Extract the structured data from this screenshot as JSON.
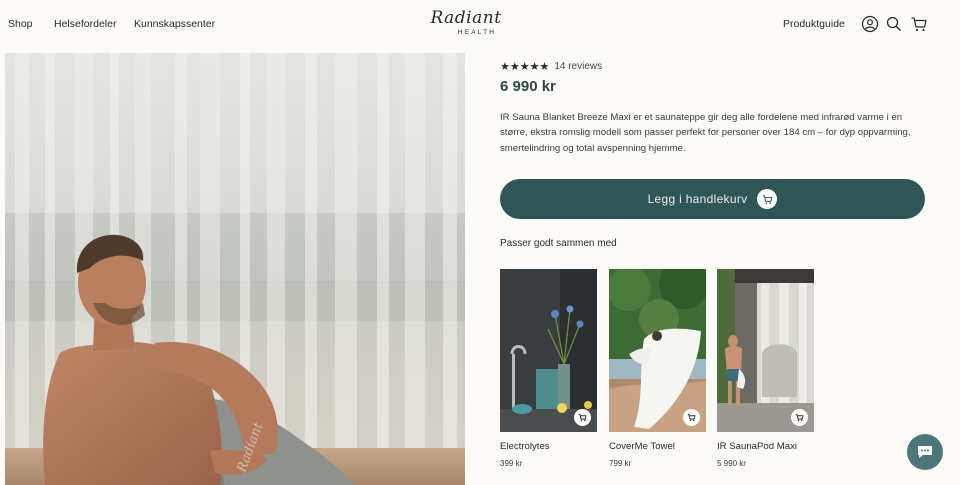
{
  "nav": {
    "shop": "Shop",
    "health": "Helsefordeler",
    "knowledge": "Kunnskapssenter",
    "product_guide": "Produktguide"
  },
  "logo": {
    "script": "Radiant",
    "sub": "HEALTH"
  },
  "icons": {
    "account": "user-circle-icon",
    "search": "search-icon",
    "cart": "cart-icon"
  },
  "product": {
    "rating_stars": "★★★★★",
    "reviews": "14 reviews",
    "price": "6 990 kr",
    "description": "IR Sauna Blanket Breeze Maxi er et saunateppe gir deg alle fordelene med infrarød varme i en større, ekstra romslig modell som passer perfekt for personer over 184 cm – for dyp oppvarming, smertelindring og total avspenning hjemme.",
    "add_to_cart": "Legg i handlekurv"
  },
  "pairs": {
    "heading": "Passer godt sammen med",
    "items": [
      {
        "name": "Electrolytes",
        "price": "399 kr"
      },
      {
        "name": "CoverMe Towel",
        "price": "799 kr"
      },
      {
        "name": "IR SaunaPod Maxi",
        "price": "5 990 kr"
      }
    ]
  },
  "colors": {
    "accent": "#2f5655",
    "price": "#2f4648",
    "chat": "#4c7778",
    "background": "#fcfbf8"
  }
}
